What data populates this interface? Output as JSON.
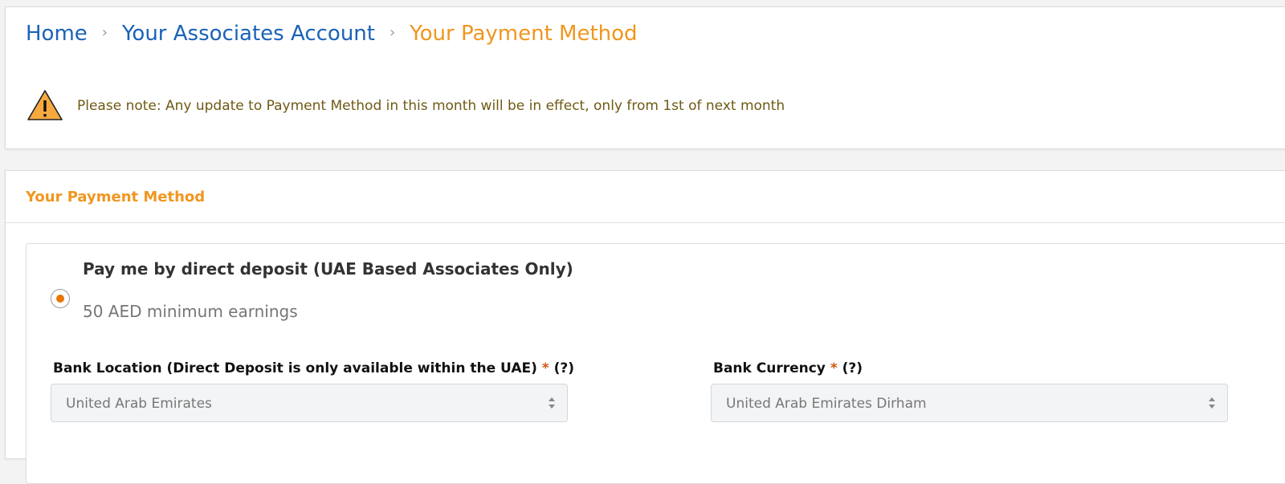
{
  "breadcrumb": {
    "home": "Home",
    "account": "Your Associates Account",
    "current": "Your Payment Method",
    "separator": "›"
  },
  "notice": {
    "icon": "warning-icon",
    "text": "Please note: Any update to Payment Method in this month will be in effect, only from 1st of next month"
  },
  "payment_method": {
    "title": "Your Payment Method",
    "option": {
      "title": "Pay me by direct deposit (UAE Based Associates Only)",
      "subtitle": "50 AED minimum earnings",
      "selected": true
    },
    "bank_location": {
      "label": "Bank Location (Direct Deposit is only available within the UAE)",
      "required_mark": "*",
      "help": "(?)",
      "value": "United Arab Emirates"
    },
    "bank_currency": {
      "label": "Bank Currency",
      "required_mark": "*",
      "help": "(?)",
      "value": "United Arab Emirates Dirham"
    }
  },
  "colors": {
    "link": "#1a62b8",
    "accent": "#f0961f",
    "notice_text": "#6e5a14",
    "radio_selected": "#e77600",
    "required": "#d0560e"
  }
}
